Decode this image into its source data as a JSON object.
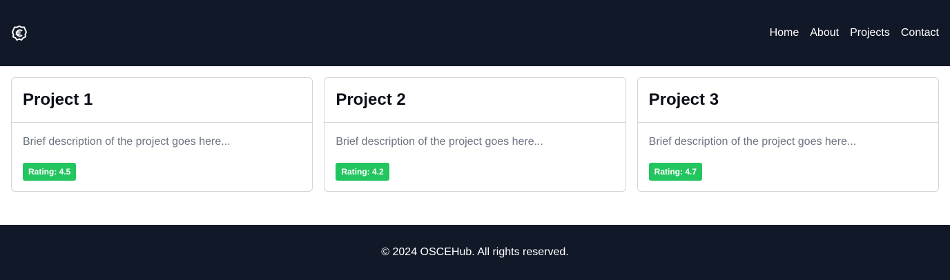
{
  "header": {
    "logo_icon": "euro-circle-icon",
    "nav": [
      {
        "label": "Home"
      },
      {
        "label": "About"
      },
      {
        "label": "Projects"
      },
      {
        "label": "Contact"
      }
    ]
  },
  "projects": [
    {
      "title": "Project 1",
      "description": "Brief description of the project goes here...",
      "rating": "Rating: 4.5"
    },
    {
      "title": "Project 2",
      "description": "Brief description of the project goes here...",
      "rating": "Rating: 4.2"
    },
    {
      "title": "Project 3",
      "description": "Brief description of the project goes here...",
      "rating": "Rating: 4.7"
    }
  ],
  "footer": {
    "text": "© 2024 OSCEHub. All rights reserved."
  },
  "colors": {
    "header_bg": "#111827",
    "footer_bg": "#111827",
    "badge_bg": "#22c55e",
    "card_border": "#d1d5db"
  }
}
